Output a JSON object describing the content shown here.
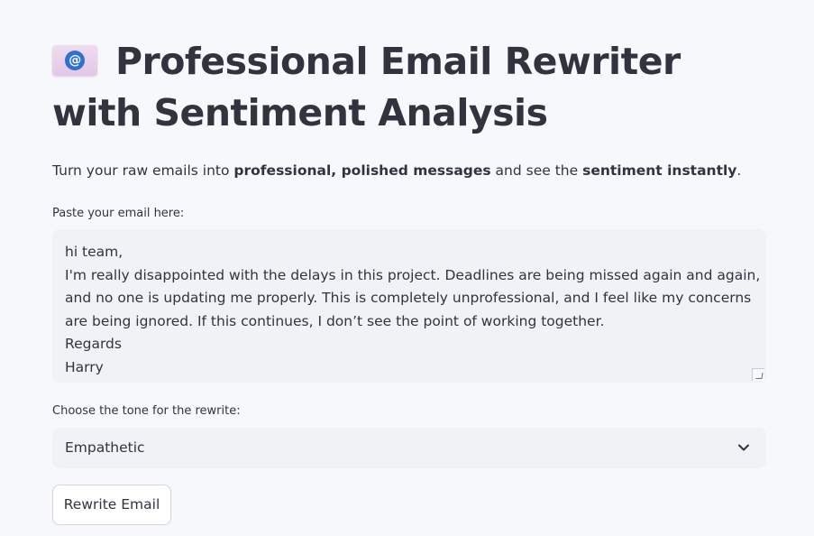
{
  "header": {
    "icon": "envelope-at-icon",
    "title": "Professional Email Rewriter with Sentiment Analysis"
  },
  "subtitle": {
    "part1": "Turn your raw emails into ",
    "bold1": "professional, polished messages",
    "part2": " and see the ",
    "bold2": "sentiment instantly",
    "part3": "."
  },
  "email_input": {
    "label": "Paste your email here:",
    "lines": [
      "hi team,",
      "I'm really disappointed with the delays in this project. Deadlines are being missed again and again,",
      "and no one is updating me properly. This is completely unprofessional, and I feel like my concerns",
      "are being ignored. If this continues, I don’t see the point of working together.",
      "Regards",
      "Harry"
    ]
  },
  "tone_select": {
    "label": "Choose the tone for the rewrite:",
    "selected": "Empathetic"
  },
  "rewrite_button": {
    "label": "Rewrite Email"
  },
  "colors": {
    "background": "#f7f8fc",
    "input_background": "#f0f2f6",
    "text": "#31333f",
    "at_icon": "#2f6fd6",
    "envelope": "#e8d0ea"
  }
}
